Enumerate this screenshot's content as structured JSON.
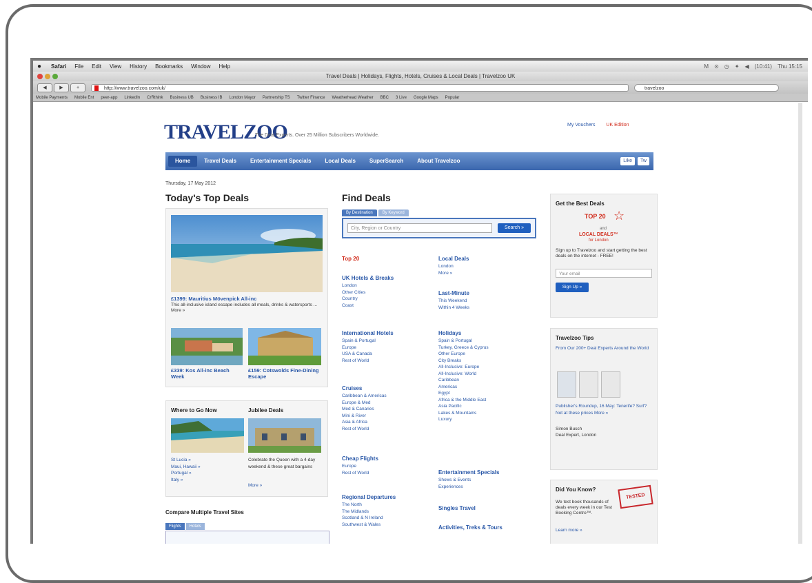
{
  "menubar": {
    "apple": "",
    "items": [
      "Safari",
      "File",
      "Edit",
      "View",
      "History",
      "Bookmarks",
      "Window",
      "Help"
    ],
    "status": [
      "M",
      "⊙",
      "◷",
      "✦",
      "◀",
      "(10:41)",
      "Thu 15:15"
    ]
  },
  "window": {
    "title": "Travel Deals | Holidays, Flights, Hotels, Cruises & Local Deals | Travelzoo UK"
  },
  "toolbar": {
    "url": "http://www.travelzoo.com/uk/",
    "search_value": "travelzoo"
  },
  "bookmarks": [
    "Mobile Payments",
    "Mobile Ent",
    "peer-app",
    "LinkedIn",
    "CrRthink",
    "Business UB",
    "Business IB",
    "London Mayor",
    "Partnership TS",
    "Twitter Finance",
    "Weatherhead Weather",
    "BBC",
    "3 Live",
    "Google Maps",
    "Popular"
  ],
  "site": {
    "logo": "TRAVELZOO",
    "tagline": "The Deal Experts. Over 25 Million Subscribers Worldwide.",
    "top_links": [
      "My Vouchers",
      "UK Edition"
    ],
    "nav": [
      "Home",
      "Travel Deals",
      "Entertainment Specials",
      "Local Deals",
      "SuperSearch",
      "About Travelzoo"
    ],
    "social": [
      "Like",
      "Tw"
    ],
    "date": "Thursday, 17 May 2012"
  },
  "top_deals": {
    "heading": "Today's Top Deals",
    "main_title": "£1399: Mauritius Mövenpick All-inc",
    "main_desc": "This all-inclusive island escape includes all meals, drinks & watersports ... More »",
    "deal2_title": "£339: Kos All-inc Beach Week",
    "deal3_title": "£159: Cotswolds Fine-Dining Escape"
  },
  "where_to_go": {
    "heading": "Where to Go Now",
    "links": [
      "St Lucia »",
      "Maui, Hawaii »",
      "Portugal »",
      "Italy »"
    ]
  },
  "jubilee": {
    "heading": "Jubilee Deals",
    "desc": "Celebrate the Queen with a 4-day weekend & these great bargains",
    "more": "More »"
  },
  "compare": {
    "heading": "Compare Multiple Travel Sites",
    "tabs": [
      "Flights",
      "Hotels"
    ]
  },
  "find_deals": {
    "heading": "Find Deals",
    "tabs": [
      "By Destination",
      "By Keyword"
    ],
    "placeholder": "City, Region or Country",
    "button": "Search »",
    "top20": "Top 20",
    "sections": [
      {
        "title": "UK Hotels & Breaks",
        "links": [
          "London",
          "Other Cities",
          "Country",
          "Coast"
        ]
      },
      {
        "title": "International Hotels",
        "links": [
          "Spain & Portugal",
          "Europe",
          "USA & Canada",
          "Rest of World"
        ]
      },
      {
        "title": "Cruises",
        "links": [
          "Caribbean & Americas",
          "Europe & Med",
          "Med & Canaries",
          "Mini & River",
          "Asia & Africa",
          "Rest of World"
        ]
      },
      {
        "title": "Cheap Flights",
        "links": [
          "Europe",
          "Rest of World"
        ]
      },
      {
        "title": "Regional Departures",
        "links": [
          "The North",
          "The Midlands",
          "Scotland & N Ireland",
          "Southwest & Wales"
        ]
      }
    ],
    "sections_right": [
      {
        "title": "Local Deals",
        "links": [
          "London",
          "More »"
        ]
      },
      {
        "title": "Last-Minute",
        "links": [
          "This Weekend",
          "Within 4 Weeks"
        ]
      },
      {
        "title": "Holidays",
        "links": [
          "Spain & Portugal",
          "Turkey, Greece & Cyprus",
          "Other Europe",
          "City Breaks",
          "All-Inclusive: Europe",
          "All-Inclusive: World",
          "Caribbean",
          "Americas",
          "Egypt",
          "Africa & the Middle East",
          "Asia Pacific",
          "Lakes & Mountains",
          "Luxury"
        ]
      },
      {
        "title": "Entertainment Specials",
        "links": [
          "Shows & Events",
          "Experiences"
        ]
      },
      {
        "title": "Singles Travel",
        "links": []
      },
      {
        "title": "Activities, Treks & Tours",
        "links": []
      }
    ]
  },
  "best_deals": {
    "heading": "Get the Best Deals",
    "badge": "TOP 20",
    "and": "and",
    "local": "LOCAL DEALS™",
    "city": "for London",
    "text": "Sign up to Travelzoo and start getting the best deals on the internet - FREE!",
    "email_placeholder": "Your email",
    "button": "Sign Up »"
  },
  "tips": {
    "heading": "Travelzoo Tips",
    "sub": "From Our 200+ Deal Experts Around the World",
    "post": "Publisher's Roundup, 16 May: Tenerife? Surf? Not at these prices More »",
    "author": "Simon Busch",
    "role": "Deal Expert, London"
  },
  "did_you_know": {
    "heading": "Did You Know?",
    "stamp": "TESTED",
    "text": "We test book thousands of deals every week in our Test Booking Centre™.",
    "more": "Learn more »"
  }
}
